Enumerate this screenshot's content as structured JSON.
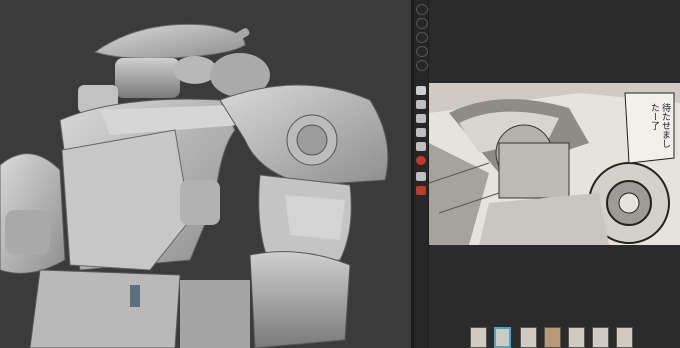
{
  "window": {
    "title": ""
  },
  "viewport": {
    "model": "robot-mech-3d-sculpt",
    "background_color": "#3b3b3b"
  },
  "toolbar": {
    "icons": [
      "circle-icon",
      "circle-icon",
      "circle-icon",
      "circle-icon",
      "circle-icon",
      "circle-icon",
      "square-icon",
      "grid-icon",
      "layers-icon",
      "brush-icon",
      "camera-icon",
      "sphere-icon",
      "pin-icon",
      "cube-icon",
      "paint-icon",
      "red-circle-icon",
      "dots-icon",
      "red-square-icon"
    ],
    "accent_color": "#c0392b"
  },
  "reference": {
    "caption": "待たせまし\nたー了",
    "thumbnails": [
      "thumb-1",
      "thumb-2",
      "thumb-3",
      "thumb-4",
      "thumb-5",
      "thumb-6",
      "thumb-7"
    ],
    "selected_thumbnail": 1,
    "selected_color": "#4aa3c8"
  }
}
